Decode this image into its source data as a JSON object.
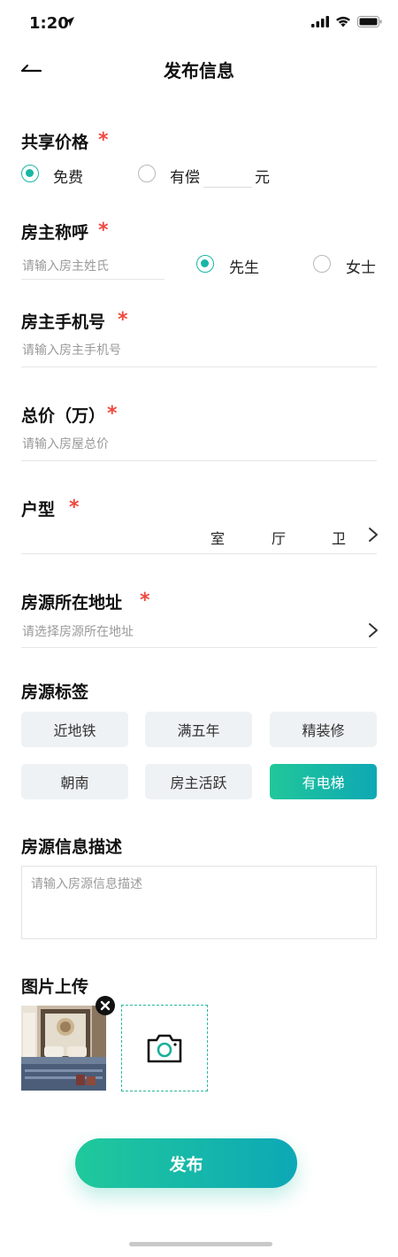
{
  "status_bar": {
    "time": "1:20"
  },
  "nav": {
    "title": "发布信息"
  },
  "price": {
    "title": "共享价格",
    "required_mark": "*",
    "options": [
      {
        "label": "免费",
        "checked": true
      },
      {
        "label": "有偿",
        "checked": false
      }
    ],
    "unit": "元"
  },
  "owner_title": {
    "title": "房主称呼",
    "required_mark": "*",
    "placeholder": "请输入房主姓氏",
    "options": [
      {
        "label": "先生",
        "checked": true
      },
      {
        "label": "女士",
        "checked": false
      }
    ]
  },
  "phone": {
    "title": "房主手机号",
    "required_mark": "*",
    "placeholder": "请输入房主手机号"
  },
  "total_price": {
    "title": "总价（万）",
    "required_mark": "*",
    "placeholder": "请输入房屋总价"
  },
  "layout": {
    "title": "户型",
    "required_mark": "*",
    "units": [
      "室",
      "厅",
      "卫"
    ]
  },
  "address": {
    "title": "房源所在地址",
    "required_mark": "*",
    "placeholder": "请选择房源所在地址"
  },
  "tags": {
    "title": "房源标签",
    "items": [
      {
        "label": "近地铁",
        "active": false
      },
      {
        "label": "满五年",
        "active": false
      },
      {
        "label": "精装修",
        "active": false
      },
      {
        "label": "朝南",
        "active": false
      },
      {
        "label": "房主活跃",
        "active": false
      },
      {
        "label": "有电梯",
        "active": true
      }
    ]
  },
  "description": {
    "title": "房源信息描述",
    "placeholder": "请输入房源信息描述"
  },
  "photos": {
    "title": "图片上传"
  },
  "publish": {
    "label": "发布"
  },
  "colors": {
    "accent": "#19b6a6",
    "required": "#f0483e",
    "gradient_start": "#20c99b",
    "gradient_end": "#0da8b6"
  },
  "icons": [
    "location-arrow-icon",
    "signal-icon",
    "wifi-icon",
    "battery-icon",
    "back-arrow-icon",
    "chevron-right-icon",
    "close-icon",
    "camera-icon"
  ]
}
